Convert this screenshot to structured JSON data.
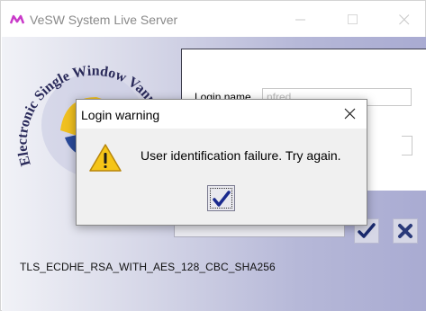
{
  "window": {
    "title": "VeSW System Live Server"
  },
  "logo": {
    "text": "Electronic Single Window Vanuatu"
  },
  "login": {
    "login_name_label": "Login name",
    "login_name_value": "nfred"
  },
  "status": {
    "cipher": "TLS_ECDHE_RSA_WITH_AES_128_CBC_SHA256"
  },
  "dialog": {
    "title": "Login warning",
    "message": "User identification failure. Try again."
  },
  "icons": {
    "app": "app-logo-icon",
    "warning": "warning-icon",
    "ok": "checkmark-icon",
    "cancel": "x-icon"
  },
  "colors": {
    "checkmark": "#1a2a6e",
    "cancel": "#2a3a7a",
    "warning_fill": "#f5c518",
    "logo_green": "#4a8a2a",
    "logo_blue": "#2a4a9a",
    "logo_yellow": "#f0c020"
  }
}
